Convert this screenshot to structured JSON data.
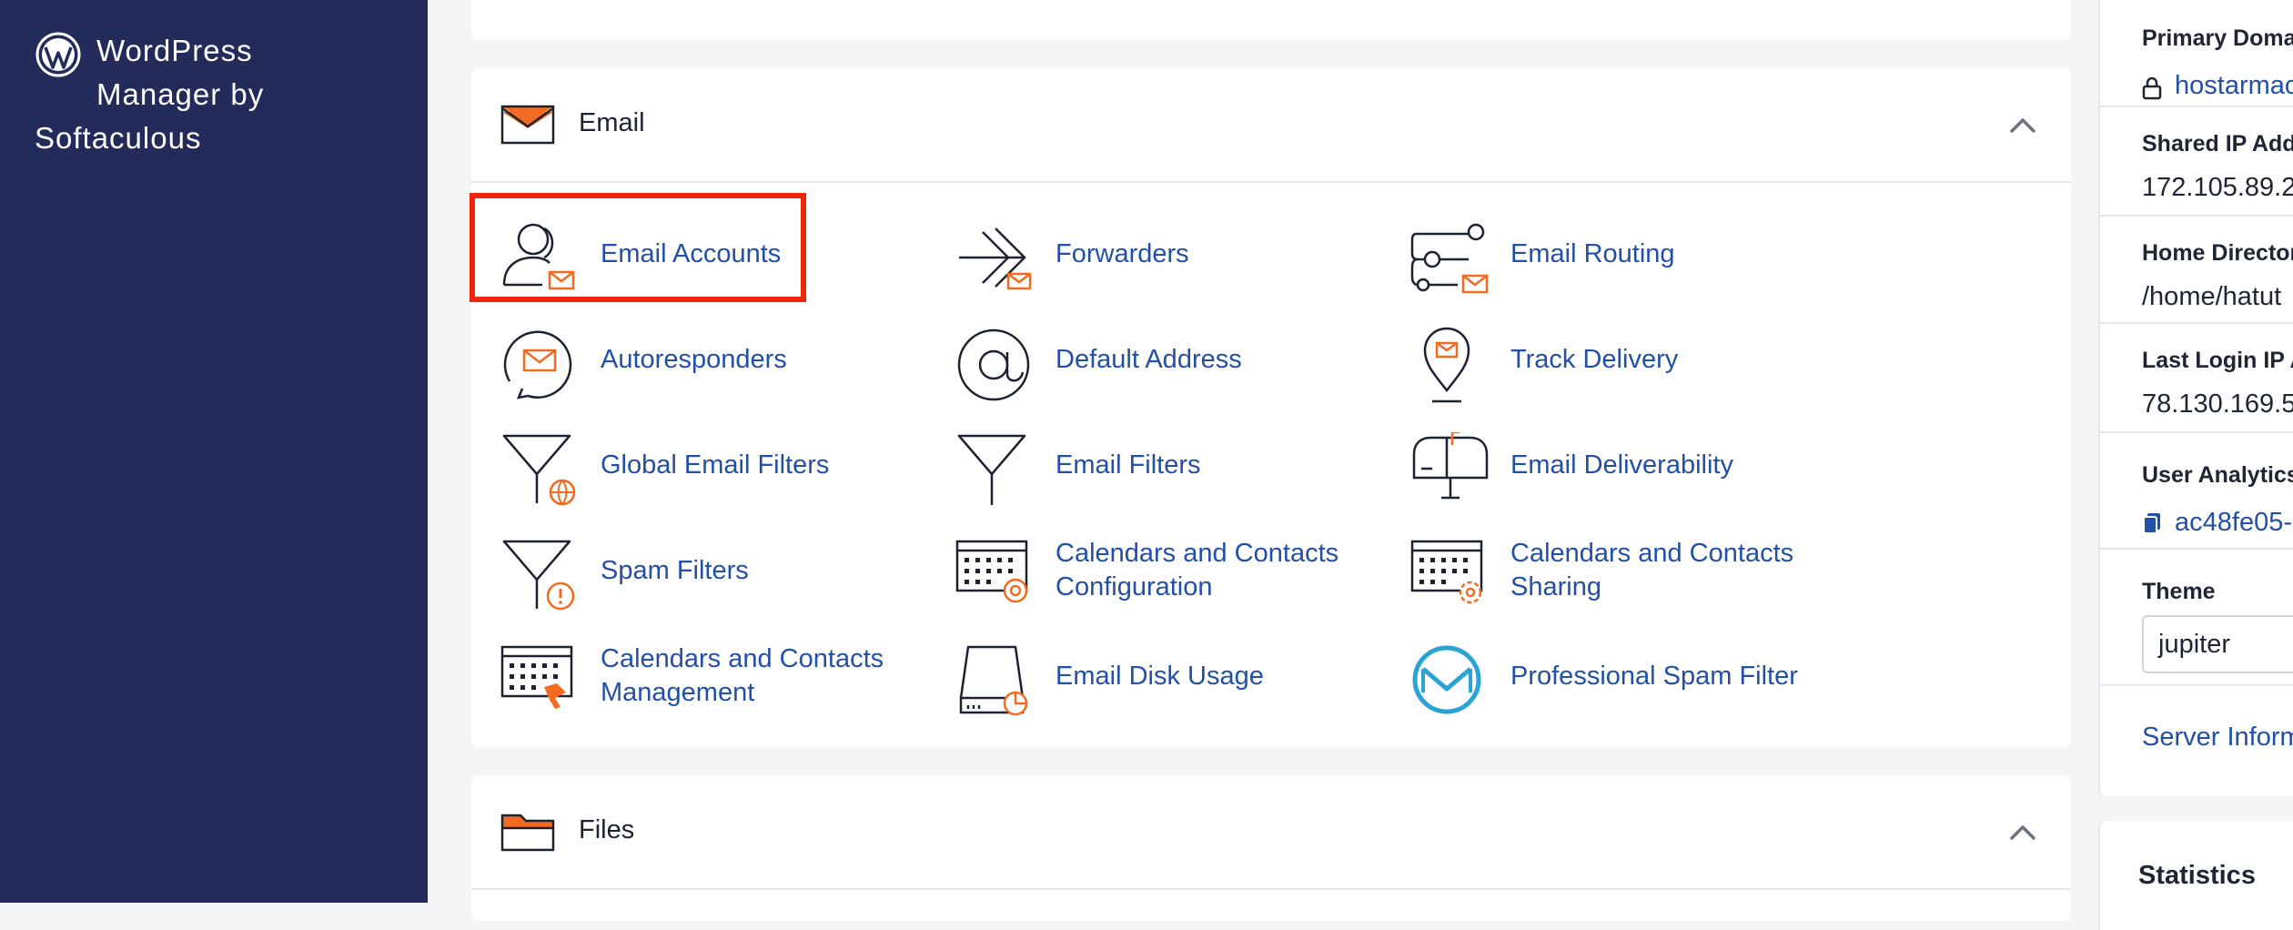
{
  "sidebar": {
    "app_line1": "WordPress",
    "app_line2": "Manager by",
    "app_line3": "Softaculous"
  },
  "email_section": {
    "title": "Email",
    "tools": [
      {
        "label": "Email Accounts",
        "icon": "email-accounts-icon"
      },
      {
        "label": "Forwarders",
        "icon": "forwarders-icon"
      },
      {
        "label": "Email Routing",
        "icon": "email-routing-icon"
      },
      {
        "label": "Autoresponders",
        "icon": "autoresponders-icon"
      },
      {
        "label": "Default Address",
        "icon": "default-address-icon"
      },
      {
        "label": "Track Delivery",
        "icon": "track-delivery-icon"
      },
      {
        "label": "Global Email Filters",
        "icon": "global-email-filters-icon"
      },
      {
        "label": "Email Filters",
        "icon": "email-filters-icon"
      },
      {
        "label": "Email Deliverability",
        "icon": "email-deliverability-icon"
      },
      {
        "label": "Spam Filters",
        "icon": "spam-filters-icon"
      },
      {
        "label": "Calendars and Contacts Configuration",
        "icon": "calendar-config-icon"
      },
      {
        "label": "Calendars and Contacts Sharing",
        "icon": "calendar-sharing-icon"
      },
      {
        "label": "Calendars and Contacts Management",
        "icon": "calendar-management-icon"
      },
      {
        "label": "Email Disk Usage",
        "icon": "disk-usage-icon"
      },
      {
        "label": "Professional Spam Filter",
        "icon": "pro-spam-filter-icon"
      }
    ]
  },
  "files_section": {
    "title": "Files"
  },
  "general_info": {
    "primary_domain_label": "Primary Doma",
    "primary_domain_value": "hostarmac",
    "shared_ip_label": "Shared IP Addr",
    "shared_ip_value": "172.105.89.2",
    "home_dir_label": "Home Director",
    "home_dir_value": "/home/hatut",
    "last_login_label": "Last Login IP A",
    "last_login_value": "78.130.169.5",
    "user_analytics_label": "User Analytics",
    "user_analytics_value": "ac48fe05-",
    "theme_label": "Theme",
    "theme_value": "jupiter",
    "server_info_link": "Server Inform"
  },
  "statistics": {
    "title": "Statistics"
  },
  "colors": {
    "sidebar_bg": "#222b5a",
    "link": "#2250a6",
    "accent_orange": "#f26b21",
    "highlight_red": "#f0260c"
  }
}
